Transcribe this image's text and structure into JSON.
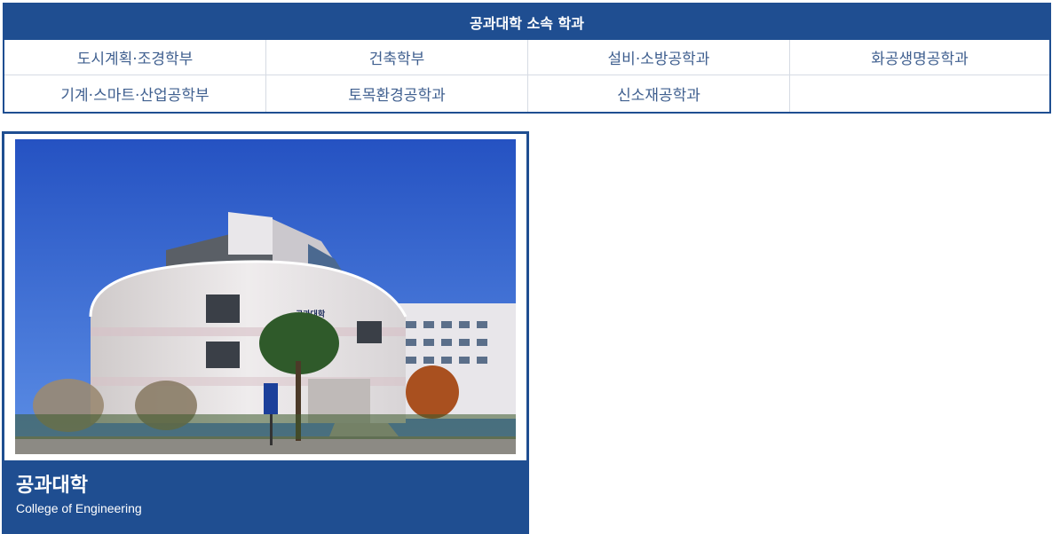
{
  "departments": {
    "title": "공과대학 소속 학과",
    "items": [
      "도시계획·조경학부",
      "건축학부",
      "설비·소방공학과",
      "화공생명공학과",
      "기계·스마트·산업공학부",
      "토목환경공학과",
      "신소재공학과",
      ""
    ]
  },
  "college": {
    "name": "공과대학",
    "english_name": "College of Engineering",
    "sign_text": "공과대학"
  },
  "colors": {
    "brand": "#1f4e91",
    "link_text": "#3f5f8f",
    "grid_line": "#d6dbe3"
  }
}
